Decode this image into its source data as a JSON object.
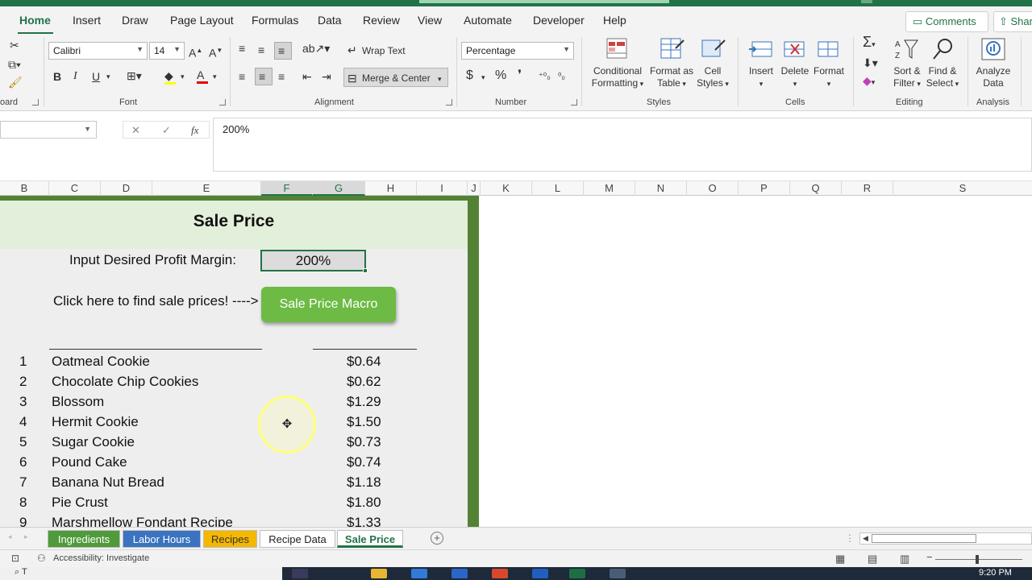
{
  "tabs": [
    "Home",
    "Insert",
    "Draw",
    "Page Layout",
    "Formulas",
    "Data",
    "Review",
    "View",
    "Automate",
    "Developer",
    "Help"
  ],
  "active_tab": "Home",
  "comments_label": "Comments",
  "share_label": "Shar",
  "ribbon": {
    "clipboard_label": "oard",
    "font_name": "Calibri",
    "font_size": "14",
    "font_label": "Font",
    "wrap_text": "Wrap Text",
    "merge_center": "Merge & Center",
    "alignment_label": "Alignment",
    "number_format": "Percentage",
    "number_label": "Number",
    "conditional_formatting": [
      "Conditional",
      "Formatting"
    ],
    "format_as_table": [
      "Format as",
      "Table"
    ],
    "cell_styles": [
      "Cell",
      "Styles"
    ],
    "styles_label": "Styles",
    "insert": "Insert",
    "delete": "Delete",
    "format": "Format",
    "cells_label": "Cells",
    "sort_filter": [
      "Sort &",
      "Filter"
    ],
    "find_select": [
      "Find &",
      "Select"
    ],
    "editing_label": "Editing",
    "analyze_data": [
      "Analyze",
      "Data"
    ],
    "analysis_label": "Analysis"
  },
  "formula_bar": {
    "name_box": "",
    "value": "200%"
  },
  "columns": [
    "B",
    "C",
    "D",
    "E",
    "F",
    "G",
    "H",
    "I",
    "J",
    "K",
    "L",
    "M",
    "N",
    "O",
    "P",
    "Q",
    "R",
    "S"
  ],
  "sheet": {
    "title": "Sale Price",
    "margin_label": "Input Desired Profit Margin:",
    "margin_value": "200%",
    "click_label": "Click here to find sale prices! ---->",
    "macro_button": "Sale Price Macro",
    "items": [
      {
        "num": "1",
        "name": "Oatmeal Cookie",
        "price": "$0.64"
      },
      {
        "num": "2",
        "name": "Chocolate Chip Cookies",
        "price": "$0.62"
      },
      {
        "num": "3",
        "name": "Blossom",
        "price": "$1.29"
      },
      {
        "num": "4",
        "name": "Hermit Cookie",
        "price": "$1.50"
      },
      {
        "num": "5",
        "name": "Sugar Cookie",
        "price": "$0.73"
      },
      {
        "num": "6",
        "name": "Pound Cake",
        "price": "$0.74"
      },
      {
        "num": "7",
        "name": "Banana Nut Bread",
        "price": "$1.18"
      },
      {
        "num": "8",
        "name": "Pie Crust",
        "price": "$1.80"
      },
      {
        "num": "9",
        "name": "Marshmellow Fondant Recipe",
        "price": "$1.33"
      }
    ]
  },
  "sheet_tabs": [
    {
      "label": "Ingredients",
      "color": "#4f9a3a"
    },
    {
      "label": "Labor Hours",
      "color": "#3a73c0"
    },
    {
      "label": "Recipes",
      "color": "#f5b800"
    },
    {
      "label": "Recipe Data",
      "color": "#ffffff"
    },
    {
      "label": "Sale Price",
      "color": "#ffffff"
    }
  ],
  "active_sheet": "Sale Price",
  "status": {
    "accessibility": "Accessibility: Investigate"
  },
  "taskbar": {
    "search": "T",
    "time": "9:20 PM"
  },
  "colors": {
    "excel_green": "#217346",
    "panel_border": "#548235",
    "macro_button": "#6dbb45",
    "title_band": "#e2efda"
  }
}
